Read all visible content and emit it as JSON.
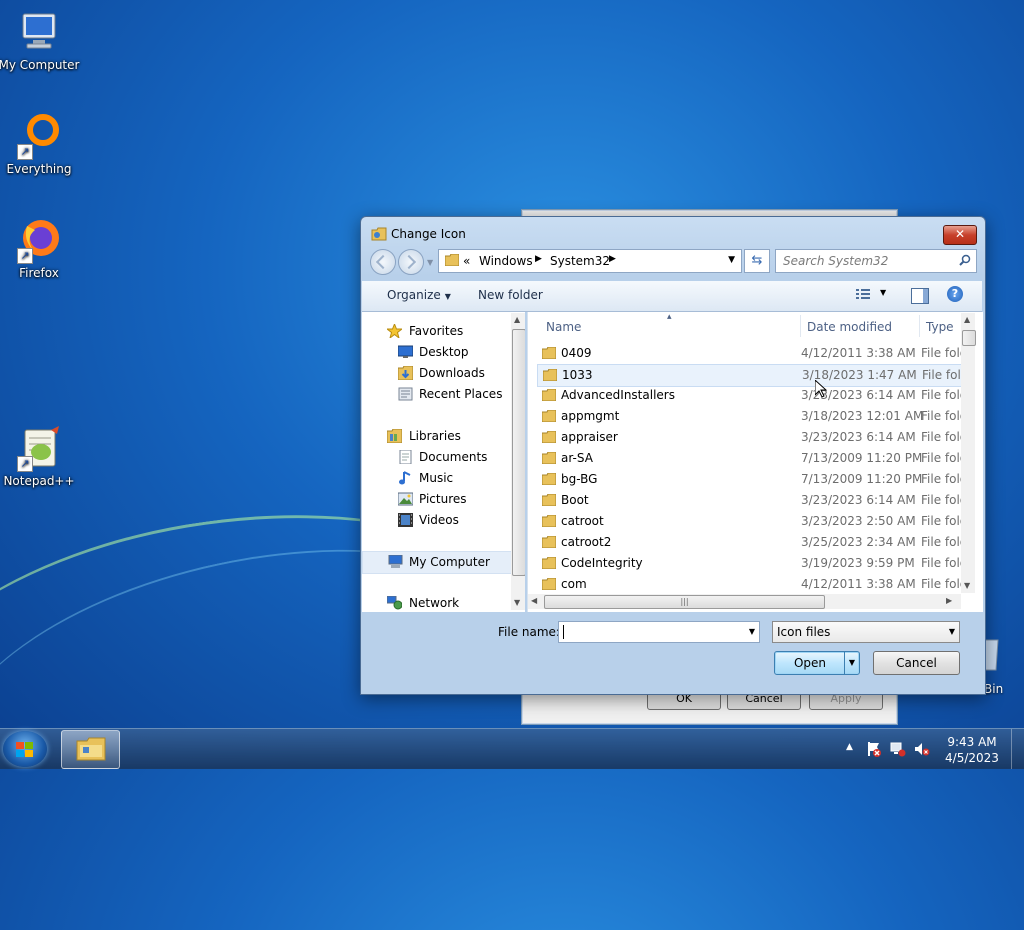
{
  "desktop": {
    "icons": [
      {
        "label": "My Computer"
      },
      {
        "label": "Everything"
      },
      {
        "label": "Firefox"
      },
      {
        "label": "Notepad++"
      }
    ],
    "recycle_label": "Bin"
  },
  "background_dialog": {
    "ok_label": "OK",
    "cancel_label": "Cancel",
    "apply_label": "Apply"
  },
  "dialog": {
    "title": "Change Icon",
    "close_glyph": "✕",
    "address": {
      "overflow": "«",
      "crumbs": [
        "Windows",
        "System32"
      ]
    },
    "search_placeholder": "Search System32",
    "toolbar": {
      "organize": "Organize",
      "new_folder": "New folder",
      "help_glyph": "?"
    },
    "nav": {
      "favorites_header": "Favorites",
      "favorites": [
        "Desktop",
        "Downloads",
        "Recent Places"
      ],
      "libraries_header": "Libraries",
      "libraries": [
        "Documents",
        "Music",
        "Pictures",
        "Videos"
      ],
      "computer": "My Computer",
      "network": "Network"
    },
    "columns": {
      "name": "Name",
      "date": "Date modified",
      "type": "Type"
    },
    "files": [
      {
        "name": "0409",
        "date": "4/12/2011 3:38 AM",
        "type": "File folder"
      },
      {
        "name": "1033",
        "date": "3/18/2023 1:47 AM",
        "type": "File folder"
      },
      {
        "name": "AdvancedInstallers",
        "date": "3/23/2023 6:14 AM",
        "type": "File folder"
      },
      {
        "name": "appmgmt",
        "date": "3/18/2023 12:01 AM",
        "type": "File folder"
      },
      {
        "name": "appraiser",
        "date": "3/23/2023 6:14 AM",
        "type": "File folder"
      },
      {
        "name": "ar-SA",
        "date": "7/13/2009 11:20 PM",
        "type": "File folder"
      },
      {
        "name": "bg-BG",
        "date": "7/13/2009 11:20 PM",
        "type": "File folder"
      },
      {
        "name": "Boot",
        "date": "3/23/2023 6:14 AM",
        "type": "File folder"
      },
      {
        "name": "catroot",
        "date": "3/23/2023 2:50 AM",
        "type": "File folder"
      },
      {
        "name": "catroot2",
        "date": "3/25/2023 2:34 AM",
        "type": "File folder"
      },
      {
        "name": "CodeIntegrity",
        "date": "3/19/2023 9:59 PM",
        "type": "File folder"
      },
      {
        "name": "com",
        "date": "4/12/2011 3:38 AM",
        "type": "File folder"
      }
    ],
    "filename_label": "File name:",
    "filename_value": "",
    "filter_value": "Icon files",
    "open_label": "Open",
    "cancel_label": "Cancel"
  },
  "taskbar": {
    "time": "9:43 AM",
    "date": "4/5/2023"
  },
  "colors": {
    "accent": "#3c7fb1",
    "folder": "#e8c15a",
    "close": "#c7412c"
  }
}
